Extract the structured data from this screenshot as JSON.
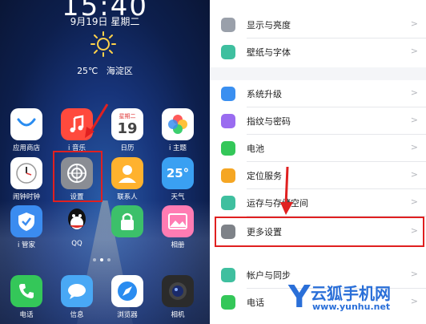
{
  "lockscreen": {
    "time": "15:40",
    "date": "9月19日  星期二",
    "temperature": "25℃",
    "location": "海淀区"
  },
  "home_icons": [
    {
      "name": "app-store",
      "label": "应用商店",
      "color": "#ffffff"
    },
    {
      "name": "music",
      "label": "i 音乐",
      "color": "#ff4a3d"
    },
    {
      "name": "calendar",
      "label": "日历",
      "color": "#ffffff"
    },
    {
      "name": "theme",
      "label": "i 主题",
      "color": "#ffffff"
    },
    {
      "name": "clock",
      "label": "闹钟时钟",
      "color": "#ffffff"
    },
    {
      "name": "settings",
      "label": "设置",
      "color": "#8a8d94"
    },
    {
      "name": "contacts",
      "label": "联系人",
      "color": "#ffb22e"
    },
    {
      "name": "weather",
      "label": "天气",
      "color": "#3aa0f2"
    },
    {
      "name": "imanager",
      "label": "i 管家",
      "color": "#3b8cf0"
    },
    {
      "name": "qq",
      "label": "QQ",
      "color": "#ffffff"
    },
    {
      "name": "lock",
      "label": "",
      "color": "#3cc06a"
    },
    {
      "name": "album",
      "label": "相册",
      "color": "#ff7cb3"
    },
    {
      "name": "phone",
      "label": "电话",
      "color": "#34c759"
    },
    {
      "name": "messages",
      "label": "信息",
      "color": "#49a8f5"
    },
    {
      "name": "browser",
      "label": "浏览器",
      "color": "#ffffff"
    },
    {
      "name": "camera",
      "label": "相机",
      "color": "#2b2b2b"
    }
  ],
  "calendar_icon": {
    "weekday": "星期二",
    "day": "19"
  },
  "weather_icon": {
    "temp": "25°"
  },
  "settings_rows": [
    {
      "label": "显示与亮度",
      "icon": "brightness-icon",
      "color": "#9aa0aa"
    },
    {
      "label": "壁纸与字体",
      "icon": "wallpaper-icon",
      "color": "#3fbf9f"
    },
    {
      "label": "系统升级",
      "icon": "upgrade-icon",
      "color": "#3a8ff0"
    },
    {
      "label": "指纹与密码",
      "icon": "fingerprint-icon",
      "color": "#9a6cf0"
    },
    {
      "label": "电池",
      "icon": "battery-icon",
      "color": "#34c759"
    },
    {
      "label": "定位服务",
      "icon": "location-icon",
      "color": "#f5a623"
    },
    {
      "label": "运存与存储空间",
      "icon": "storage-icon",
      "color": "#3fbf9f"
    },
    {
      "label": "更多设置",
      "icon": "wrench-icon",
      "color": "#7e8288"
    },
    {
      "label": "帐户与同步",
      "icon": "cloud-icon",
      "color": "#3fbf9f"
    },
    {
      "label": "电话",
      "icon": "phone-icon",
      "color": "#34c759"
    }
  ],
  "watermark": {
    "text": "云狐手机网",
    "url": "www.yunhu.net",
    "logo": "Y"
  },
  "highlight_color": "#e02020"
}
